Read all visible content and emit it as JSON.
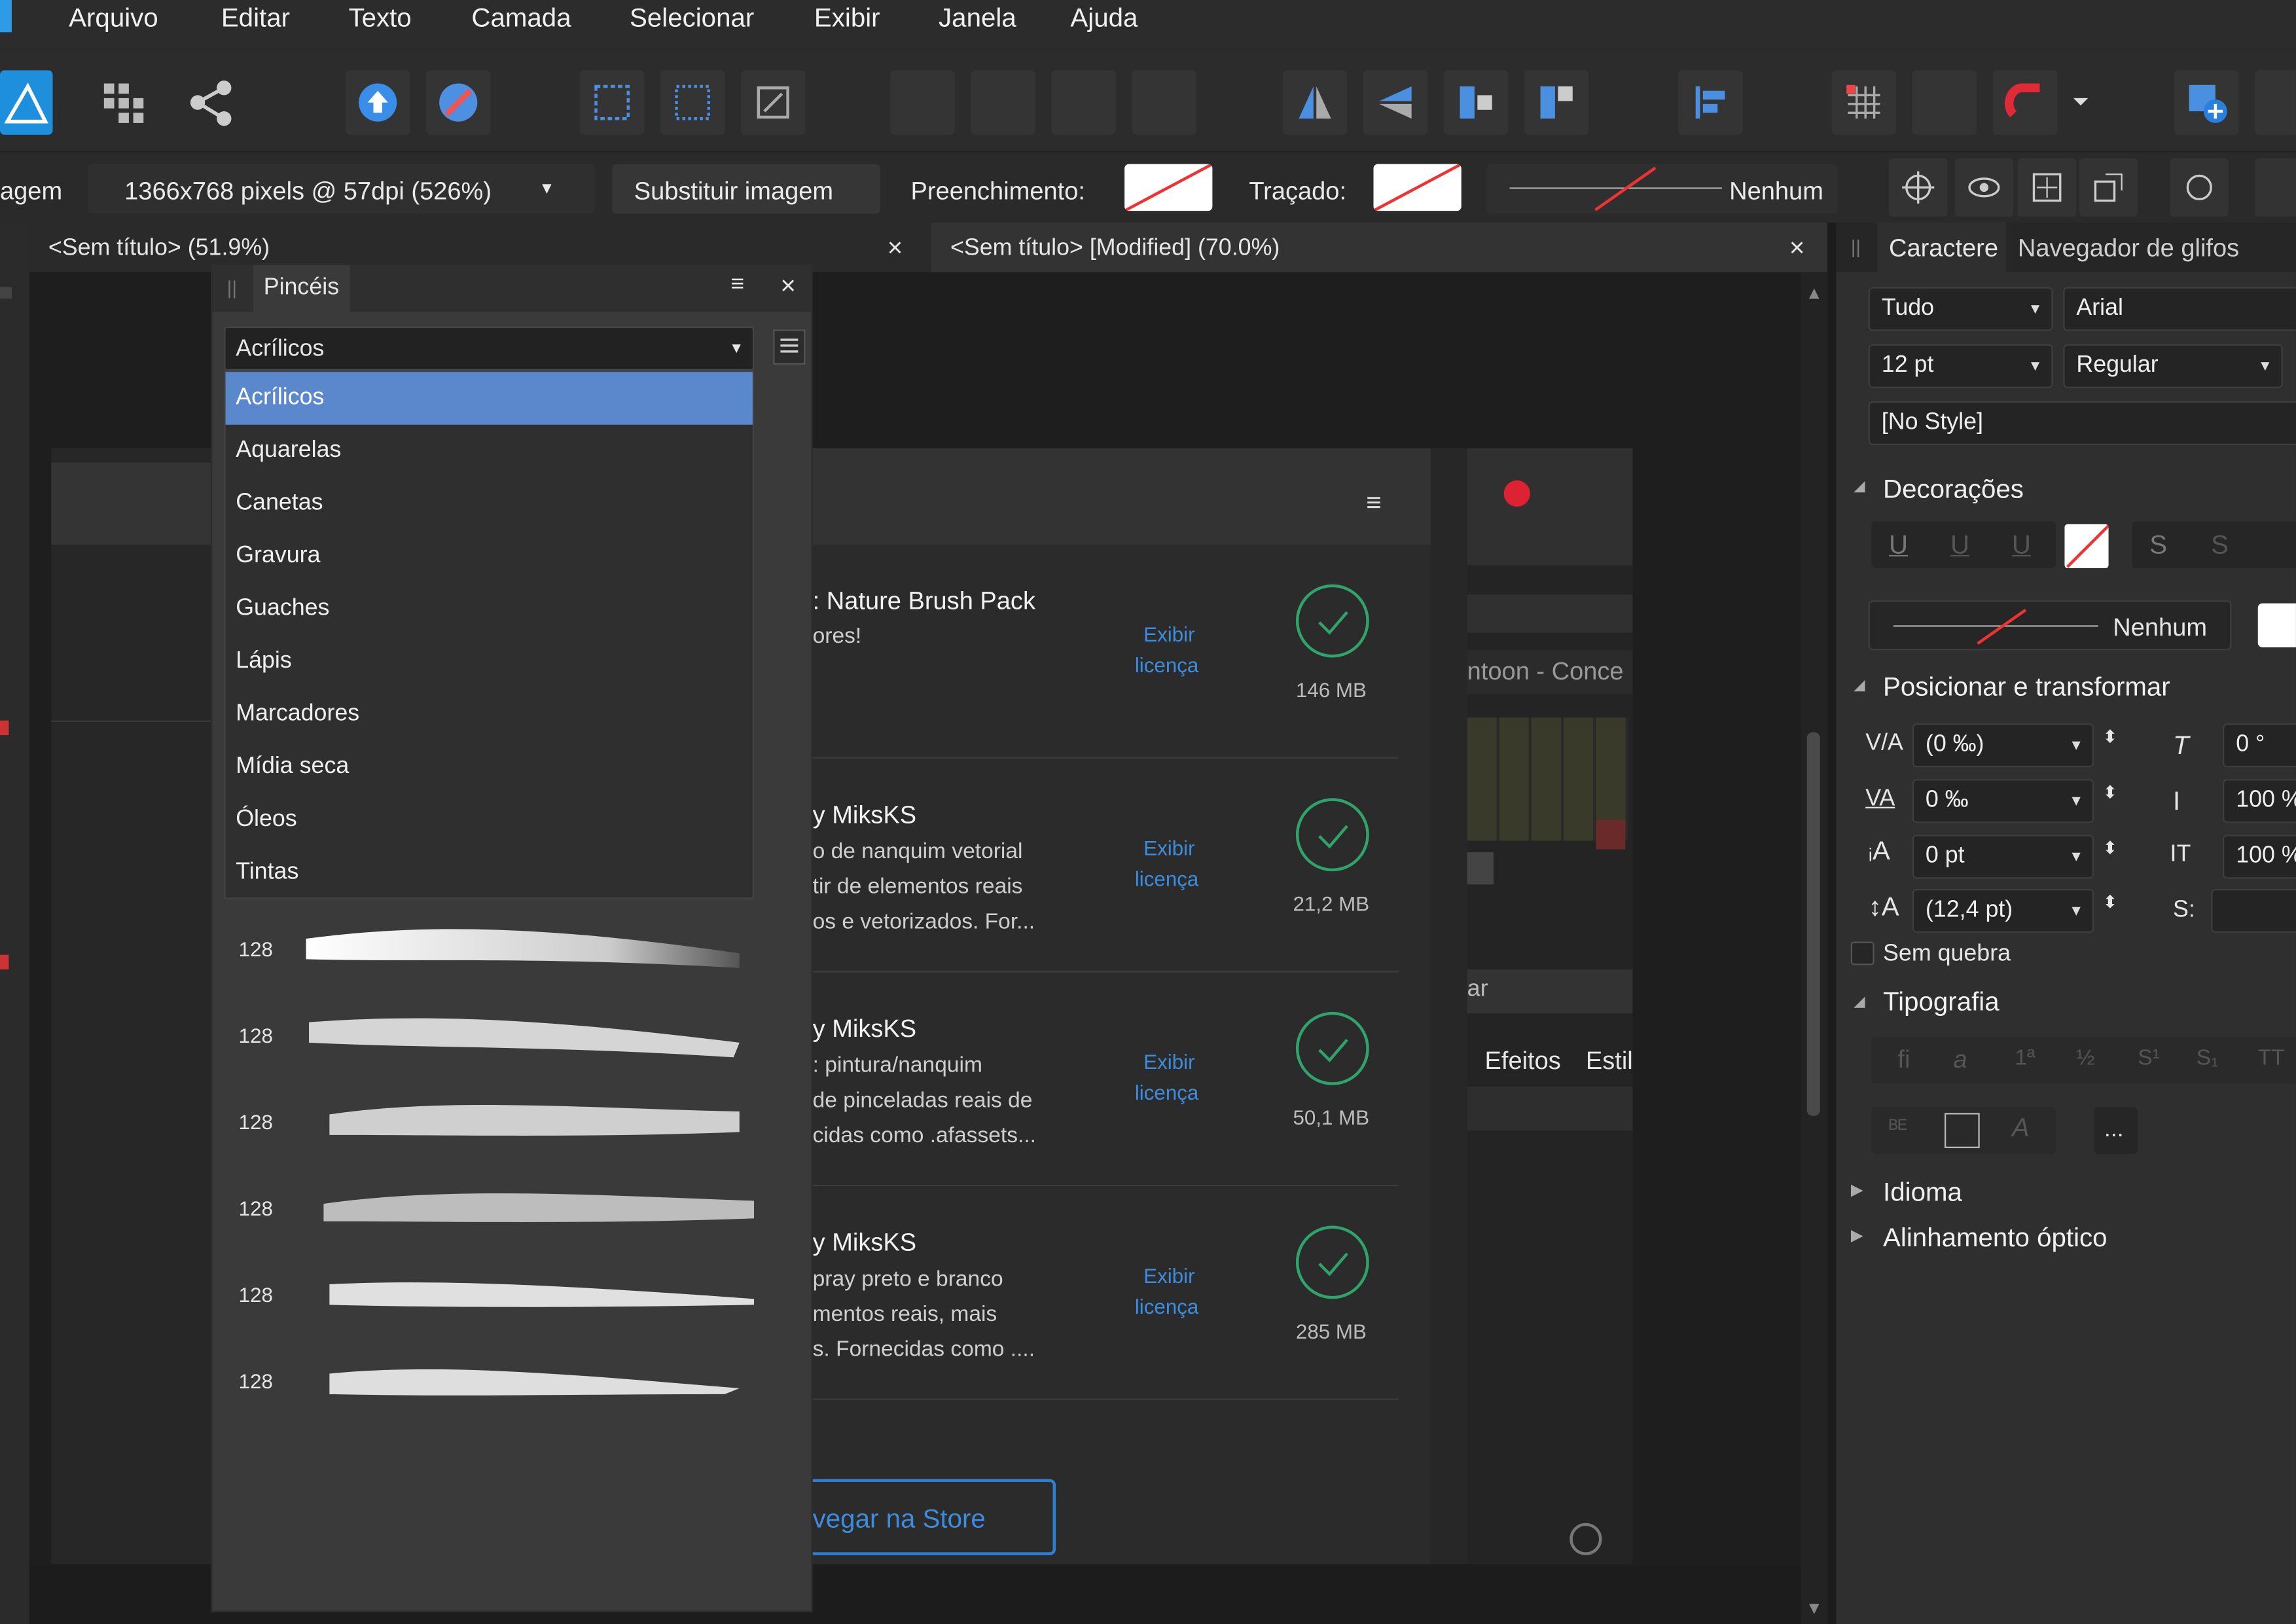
{
  "menu": [
    "Arquivo",
    "Editar",
    "Texto",
    "Camada",
    "Selecionar",
    "Exibir",
    "Janela",
    "Ajuda"
  ],
  "context": {
    "left_text": "agem",
    "pixel_info": "1366x768 pixels @ 57dpi (526%)",
    "replace_button": "Substituir imagem",
    "fill_label": "Preenchimento:",
    "stroke_label": "Traçado:",
    "stroke_value": "Nenhum"
  },
  "tabs": {
    "left": "<Sem título> (51.9%)",
    "right": "<Sem título> [Modified] (70.0%)",
    "close": "×"
  },
  "brushes_panel": {
    "title": "Pincéis",
    "category": "Acrílicos",
    "options": [
      "Acrílicos",
      "Aquarelas",
      "Canetas",
      "Gravura",
      "Guaches",
      "Lápis",
      "Marcadores",
      "Mídia seca",
      "Óleos",
      "Tintas"
    ],
    "brush_sizes": [
      "128",
      "128",
      "128",
      "128",
      "128",
      "128"
    ]
  },
  "store": {
    "cards": [
      {
        "title": ": Nature Brush Pack",
        "desc": [
          "ores!"
        ],
        "license": [
          "Exibir",
          "licença"
        ],
        "size": "146 MB"
      },
      {
        "title": "y MiksKS",
        "desc": [
          "o de nanquim vetorial",
          "tir de elementos reais",
          "os e vetorizados. For..."
        ],
        "license": [
          "Exibir",
          "licença"
        ],
        "size": "21,2 MB"
      },
      {
        "title": "y MiksKS",
        "desc": [
          ": pintura/nanquim",
          "de pinceladas reais de",
          "cidas como .afassets..."
        ],
        "license": [
          "Exibir",
          "licença"
        ],
        "size": "50,1 MB"
      },
      {
        "title": "y MiksKS",
        "desc": [
          "pray preto e branco",
          "mentos reais, mais",
          "s. Fornecidas como ...."
        ],
        "license": [
          "Exibir",
          "licença"
        ],
        "size": "285 MB"
      }
    ],
    "browse_button": "vegar na Store"
  },
  "behind": {
    "search_text": "ntoon - Conce",
    "ar_text": "ar",
    "effects_tab": "Efeitos",
    "styles_tab": "Estil"
  },
  "character_panel": {
    "tabs": [
      "Caractere",
      "Navegador de glifos"
    ],
    "scope": "Tudo",
    "font": "Arial",
    "size": "12 pt",
    "weight": "Regular",
    "style": "[No Style]",
    "decorations_title": "Decorações",
    "line_value": "Nenhum",
    "position_title": "Posicionar e transformar",
    "kerning": "(0 ‰)",
    "tracking": "0 ‰",
    "baseline": "0 pt",
    "leading": "(12,4 pt)",
    "shear": "0 °",
    "vscale": "100 %",
    "hscale": "100 %",
    "s_label": "S:",
    "no_break": "Sem quebra",
    "typography_title": "Tipografia",
    "more_button": "...",
    "language_title": "Idioma",
    "optical_title": "Alinhamento óptico"
  },
  "colors": {
    "accent": "#5b87cc",
    "link": "#3c8dde",
    "ok": "#2fa36a"
  }
}
